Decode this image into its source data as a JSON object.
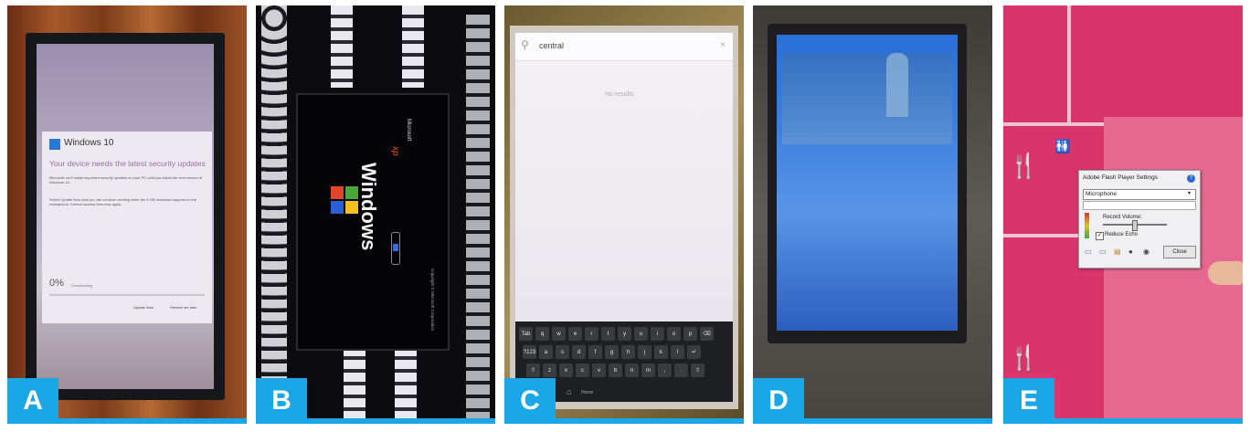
{
  "panels": [
    {
      "label": "A",
      "screen": {
        "brand": "Windows 10",
        "heading": "Your device needs the latest security updates",
        "body": "Microsoft can't install important security updates on your PC until you install the next version of Windows 10.",
        "body2": "Select Update Now and you can continue working while the 3 GB download happens in the background. Internet access fees may apply.",
        "progress": "0%",
        "progress_fraction": 0,
        "progress_note": "Downloading",
        "buttons": [
          "Update Now",
          "Remind me later"
        ]
      }
    },
    {
      "label": "B",
      "screen": {
        "brand": "Microsoft",
        "product": "Windows",
        "edition": "xp",
        "copyright": "Copyright © Microsoft Corporation"
      }
    },
    {
      "label": "C",
      "screen": {
        "search_value": "central",
        "no_results": "No results",
        "keyboard_rows": [
          [
            "Tab",
            "q",
            "w",
            "e",
            "r",
            "t",
            "y",
            "u",
            "i",
            "o",
            "p",
            "⌫"
          ],
          [
            "?123",
            "a",
            "s",
            "d",
            "f",
            "g",
            "h",
            "j",
            "k",
            "l",
            "↵"
          ],
          [
            "⇧",
            "z",
            "x",
            "c",
            "v",
            "b",
            "n",
            "m",
            ",",
            ".",
            "⇧"
          ]
        ],
        "nav_label": "Home"
      }
    },
    {
      "label": "D",
      "screen": {}
    },
    {
      "label": "E",
      "screen": {
        "dialog_title": "Adobe Flash Player Settings",
        "device": "Microphone",
        "record_volume": "Record Volume:",
        "reduce_echo": "Reduce Echo",
        "close": "Close"
      }
    }
  ],
  "colors": {
    "accent": "#1aa7e8",
    "map_pink": "#d9356c"
  }
}
